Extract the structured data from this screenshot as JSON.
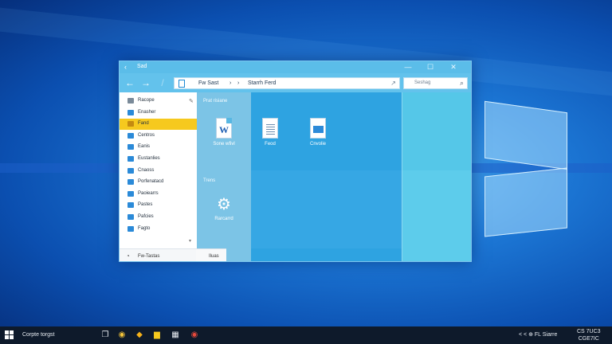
{
  "window": {
    "title": "Sad",
    "controls": {
      "minimize": "—",
      "maximize": "☐",
      "close": "✕"
    }
  },
  "toolbar": {
    "address_segments": [
      "Fw Sast",
      "›",
      "›",
      "Starrh Ferd"
    ],
    "search_placeholder": "Seshag"
  },
  "nav": {
    "items": [
      {
        "label": "Racope",
        "color": "#7a8a99",
        "selected": false
      },
      {
        "label": "Enasher",
        "color": "#2b8ad8",
        "selected": false
      },
      {
        "label": "Fand",
        "color": "#2b8ad8",
        "selected": true
      },
      {
        "label": "Centros",
        "color": "#2b8ad8",
        "selected": false
      },
      {
        "label": "Eanis",
        "color": "#2b8ad8",
        "selected": false
      },
      {
        "label": "Eustanlies",
        "color": "#2b8ad8",
        "selected": false
      },
      {
        "label": "Cnaoss",
        "color": "#2b8ad8",
        "selected": false
      },
      {
        "label": "Porfenatacd",
        "color": "#2b8ad8",
        "selected": false
      },
      {
        "label": "Paoiearrs",
        "color": "#2b8ad8",
        "selected": false
      },
      {
        "label": "Pastes",
        "color": "#2b8ad8",
        "selected": false
      },
      {
        "label": "Pafcies",
        "color": "#2b8ad8",
        "selected": false
      },
      {
        "label": "Fagto",
        "color": "#2b8ad8",
        "selected": false
      }
    ],
    "footer": {
      "left_label": "Fw-Tastas",
      "right_label": "Iluas"
    }
  },
  "content": {
    "section1_title": "Prat risiane",
    "section2_title": "Trens",
    "files": [
      {
        "label": "Sone wfivl",
        "letter": "W",
        "icon": "word-doc-icon"
      },
      {
        "label": "Feod",
        "letter": "",
        "icon": "text-doc-icon"
      },
      {
        "label": "Cnvolie",
        "letter": "",
        "icon": "blue-doc-icon"
      }
    ],
    "settings_label": "Rarcarrd"
  },
  "taskbar": {
    "search_text": "Corpte torgst",
    "apps": [
      {
        "name": "task-view-icon",
        "glyph": "❐",
        "color": "#e7ecf2"
      },
      {
        "name": "browser-icon",
        "glyph": "◉",
        "color": "#f3c43a"
      },
      {
        "name": "store-icon",
        "glyph": "◆",
        "color": "#f6b21a"
      },
      {
        "name": "file-explorer-icon",
        "glyph": "▆",
        "color": "#f6c91e"
      },
      {
        "name": "calendar-icon",
        "glyph": "▦",
        "color": "#e7ecf2"
      },
      {
        "name": "chrome-icon",
        "glyph": "◉",
        "color": "#e64a3c"
      }
    ],
    "tray_text": "< < ⊕ FL Siarre",
    "clock_top": "CS 7UC3",
    "clock_bottom": "CGE7IC"
  },
  "colors": {
    "accent": "#1c8ad4",
    "selected": "#f6c91e",
    "window": "#3aa7de"
  }
}
